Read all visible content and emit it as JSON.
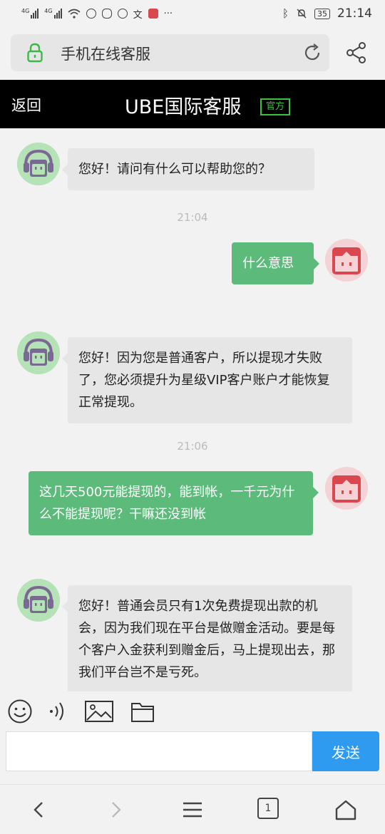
{
  "status_bar": {
    "sim1": "4G",
    "sim2": "4G",
    "battery": "35",
    "time": "21:14",
    "icons": [
      "signal-icon",
      "wifi-icon",
      "alert-icon",
      "wechat-icon",
      "vpn-icon",
      "translate-icon",
      "app-icon",
      "more-icon",
      "bluetooth-icon",
      "mute-icon",
      "battery-icon"
    ]
  },
  "browser": {
    "url_text": "手机在线客服",
    "lock_icon": "lock-icon",
    "reload_icon": "reload-icon",
    "share_icon": "share-icon"
  },
  "header": {
    "back_label": "返回",
    "title": "UBE国际客服",
    "badge": "官方"
  },
  "messages": [
    {
      "side": "in",
      "text": "您好！请问有什么可以帮助您的？"
    },
    {
      "side": "time",
      "text": "21:04"
    },
    {
      "side": "out",
      "text": "什么意思"
    },
    {
      "side": "in",
      "text": "您好！因为您是普通客户，所以提现才失败了，您必须提升为星级VIP客户账户才能恢复正常提现。"
    },
    {
      "side": "time",
      "text": "21:06"
    },
    {
      "side": "out",
      "text": "这几天500元能提现的，能到帐，一千元为什么不能提现呢？干嘛还没到帐"
    },
    {
      "side": "in",
      "text": "您好！普通会员只有1次免费提现出款的机会，因为我们现在平台是做赠金活动。要是每个客户入金获利到赠金后，马上提现出去，那我们平台岂不是亏死。"
    }
  ],
  "toolbar": {
    "icons": [
      "emoji-icon",
      "voice-icon",
      "image-icon",
      "folder-icon"
    ]
  },
  "composer": {
    "input_value": "",
    "send_label": "发送"
  },
  "bottom_nav": {
    "tab_count": "1",
    "icons": [
      "back-arrow-icon",
      "forward-arrow-icon",
      "menu-icon",
      "tabs-icon",
      "home-icon"
    ]
  },
  "colors": {
    "header_bg": "#000000",
    "badge_green": "#3cc13c",
    "out_bubble": "#5cbb7b",
    "in_bubble": "#e6e6e6",
    "send_button": "#2e9af0",
    "agent_avatar_bg": "#b5e2b7",
    "user_avatar_bg": "#f5d2d5"
  }
}
